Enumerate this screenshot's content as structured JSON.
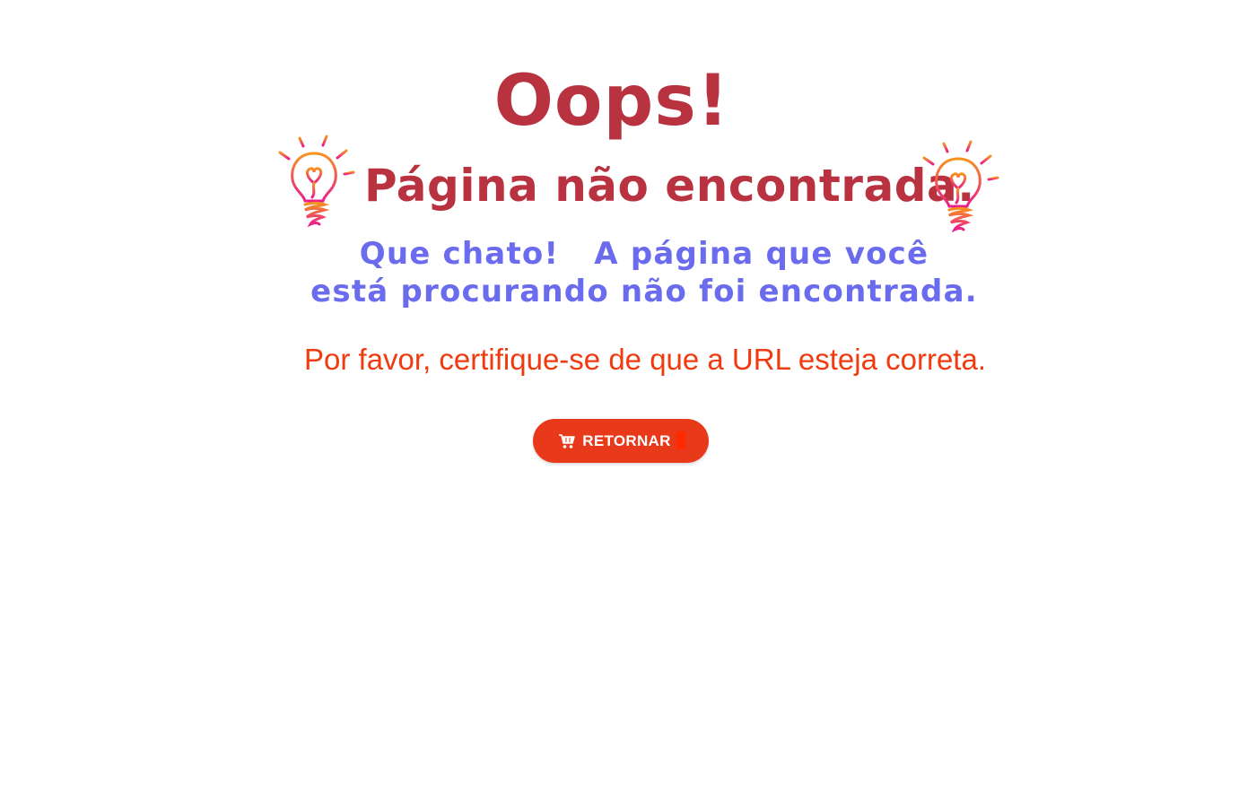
{
  "header": {
    "title": "Oops!",
    "subtitle": "Página não encontrada."
  },
  "message": {
    "line1": "Que chato!   A página que você",
    "line2": "está procurando não foi encontrada."
  },
  "hint": "Por favor, certifique-se de que a URL esteja correta.",
  "button": {
    "label": "RETORNAR",
    "icon": "cart-icon",
    "color": "#e8391a"
  },
  "icons": {
    "left": "lightbulb-heart-icon",
    "right": "lightbulb-heart-icon"
  },
  "colors": {
    "title": "#b83240",
    "message": "#6b6bee",
    "hint": "#f03a10"
  }
}
